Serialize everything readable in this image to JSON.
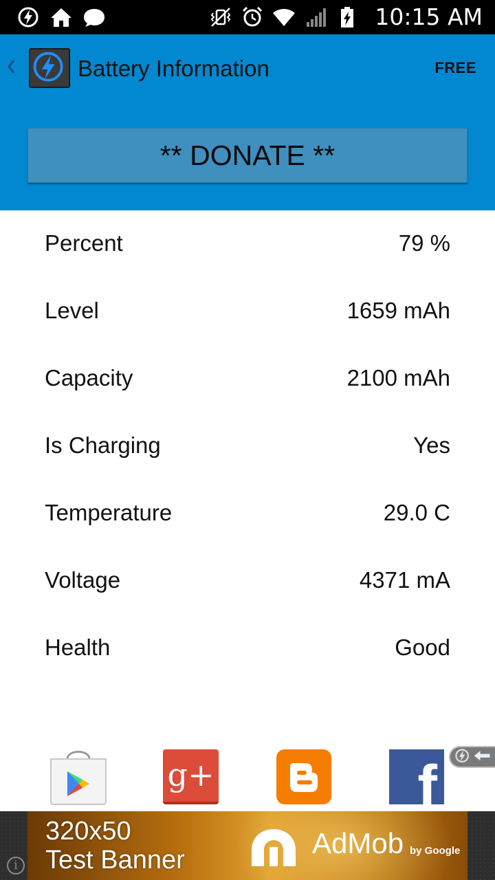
{
  "status_bar": {
    "time": "10:15 AM",
    "left_icons": [
      "battery-app-notification-icon",
      "home-icon",
      "chat-bubble-icon"
    ],
    "right_icons": [
      "vibrate-mute-icon",
      "alarm-clock-icon",
      "wifi-icon",
      "signal-bars-icon",
      "battery-charging-icon"
    ]
  },
  "app_bar": {
    "title": "Battery Information",
    "badge": "FREE",
    "icon": "lightning-bolt-icon"
  },
  "donate_button": {
    "label": "** DONATE **"
  },
  "info": [
    {
      "label": "Percent",
      "value": "79 %"
    },
    {
      "label": "Level",
      "value": "1659 mAh"
    },
    {
      "label": "Capacity",
      "value": "2100 mAh"
    },
    {
      "label": "Is Charging",
      "value": "Yes"
    },
    {
      "label": "Temperature",
      "value": "29.0 C"
    },
    {
      "label": "Voltage",
      "value": "4371 mA"
    },
    {
      "label": "Health",
      "value": "Good"
    }
  ],
  "social": {
    "icons": [
      "google-play-store-icon",
      "google-plus-icon",
      "blogger-icon",
      "facebook-icon"
    ],
    "gplus_text": "g+",
    "facebook_text": "f"
  },
  "ad": {
    "line1": "320x50",
    "line2": "Test Banner",
    "brand": "AdMob",
    "byline": "by Google",
    "info_glyph": "i"
  },
  "colors": {
    "app_bar": "#0288d1",
    "donate_button": "#3f8fbf",
    "status_bar": "#000000",
    "text": "#111111",
    "gplus": "#dd4b39",
    "blogger": "#f57d00",
    "facebook": "#3b5998"
  }
}
